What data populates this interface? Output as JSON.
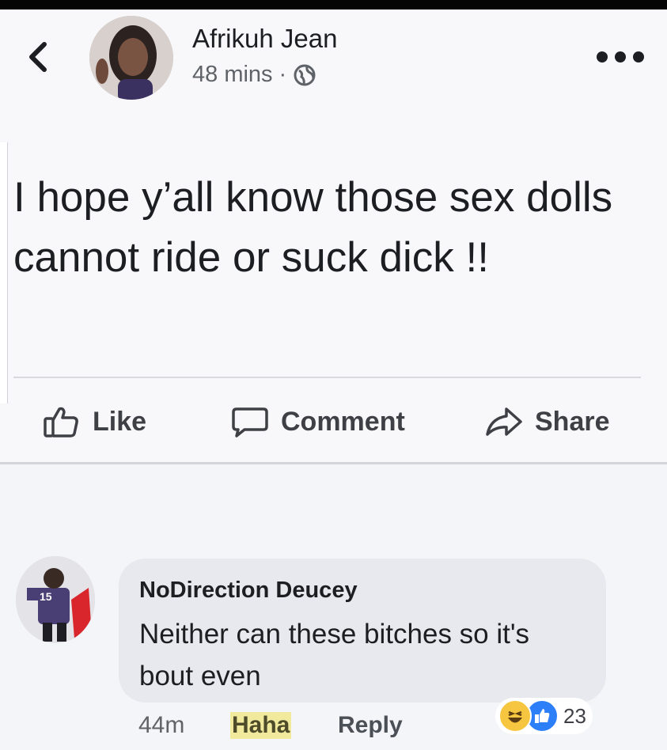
{
  "post": {
    "author": "Afrikuh Jean",
    "time": "48 mins",
    "separator": "·",
    "privacy_icon": "globe-icon",
    "text": "I hope y’all know those sex dolls cannot ride or suck dick  !!"
  },
  "actions": {
    "like": "Like",
    "comment": "Comment",
    "share": "Share"
  },
  "comment": {
    "author": "NoDirection Deucey",
    "text": "Neither can these bitches so it's bout even",
    "time": "44m",
    "haha_label": "Haha",
    "reply_label": "Reply",
    "reaction_count": "23",
    "reaction_icons": [
      "haha-emoji-icon",
      "like-emoji-icon"
    ],
    "jersey_number": "15"
  },
  "colors": {
    "background": "#f8f8fb",
    "text": "#1c1e21",
    "secondary_text": "#5f6368",
    "bubble": "#e8e9ee",
    "haha_highlight": "#f1ea9d",
    "like_blue": "#2d7ff9"
  }
}
